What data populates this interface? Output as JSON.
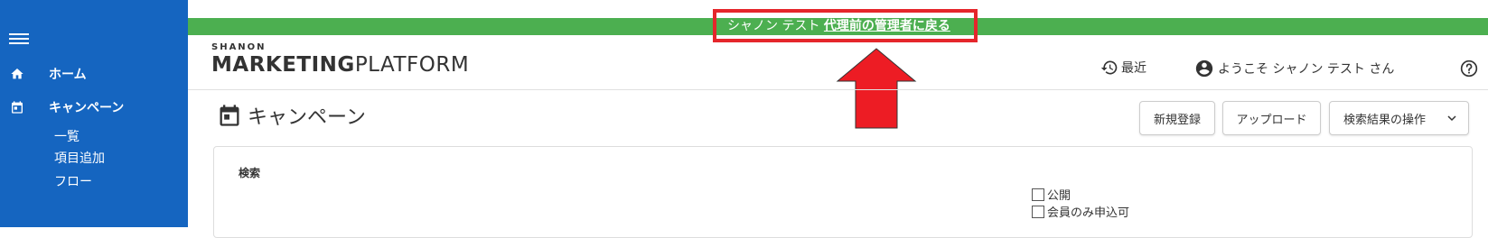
{
  "banner": {
    "user_prefix": "シャノン テスト",
    "return_link": "代理前の管理者に戻る",
    "bg_color": "#4caf50",
    "highlight_color": "#e5262b"
  },
  "logo": {
    "small": "SHANON",
    "main_bold": "MARKETING",
    "main_light": "PLATFORM"
  },
  "header": {
    "recent_label": "最近",
    "welcome_label": "ようこそ シャノン テスト さん",
    "help_icon": "help-icon"
  },
  "sidebar": {
    "bg_color": "#1565c0",
    "items": [
      {
        "label": "ホーム",
        "icon": "home-icon"
      },
      {
        "label": "キャンペーン",
        "icon": "calendar-icon"
      }
    ],
    "sub_items": [
      {
        "label": "一覧"
      },
      {
        "label": "項目追加"
      },
      {
        "label": "フロー"
      }
    ]
  },
  "page": {
    "title": "キャンペーン",
    "buttons": {
      "new": "新規登録",
      "upload": "アップロード",
      "search_ops": "検索結果の操作"
    }
  },
  "search": {
    "title": "検索",
    "checkboxes": [
      {
        "label": "公開",
        "checked": false
      },
      {
        "label": "会員のみ申込可",
        "checked": false
      }
    ]
  }
}
